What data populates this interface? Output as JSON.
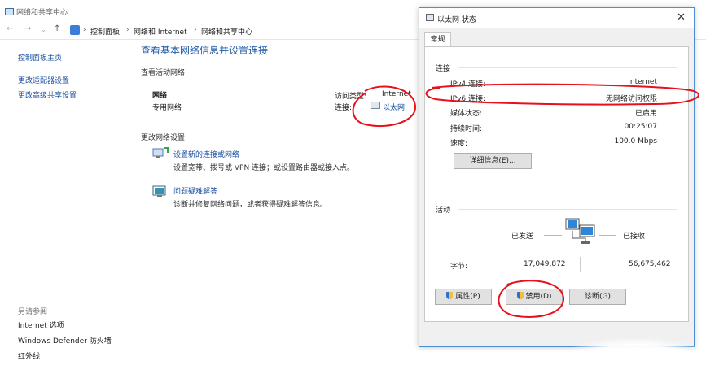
{
  "window": {
    "title": "网络和共享中心",
    "breadcrumb": [
      "控制面板",
      "网络和 Internet",
      "网络和共享中心"
    ]
  },
  "sidebar": {
    "home_link": "控制面板主页",
    "links": [
      "更改适配器设置",
      "更改高级共享设置"
    ],
    "see_also_label": "另请参阅",
    "see_also": [
      "Internet 选项",
      "Windows Defender 防火墙",
      "红外线"
    ]
  },
  "main": {
    "heading": "查看基本网络信息并设置连接",
    "active_networks_label": "查看活动网络",
    "network_name": "网络",
    "network_type": "专用网络",
    "access_type_label": "访问类型:",
    "access_type_value": "Internet",
    "connection_label": "连接:",
    "connection_value": "以太网",
    "change_settings_label": "更改网络设置",
    "items": [
      {
        "title": "设置新的连接或网络",
        "desc": "设置宽带、拨号或 VPN 连接；或设置路由器或接入点。"
      },
      {
        "title": "问题疑难解答",
        "desc": "诊断并修复网络问题，或者获得疑难解答信息。"
      }
    ]
  },
  "dialog": {
    "title": "以太网 状态",
    "tab": "常规",
    "connection_group": "连接",
    "fields": [
      {
        "key": "IPv4 连接:",
        "value": "Internet"
      },
      {
        "key": "IPv6 连接:",
        "value": "无网络访问权限"
      },
      {
        "key": "媒体状态:",
        "value": "已启用"
      },
      {
        "key": "持续时间:",
        "value": "00:25:07"
      },
      {
        "key": "速度:",
        "value": "100.0 Mbps"
      }
    ],
    "details_button": "详细信息(E)...",
    "activity_group": "活动",
    "sent_label": "已发送",
    "received_label": "已接收",
    "bytes_label": "字节:",
    "bytes_sent": "17,049,872",
    "bytes_received": "56,675,462",
    "buttons": {
      "properties": "属性(P)",
      "disable": "禁用(D)",
      "diagnose": "诊断(G)"
    }
  },
  "colors": {
    "link": "#1a4fa0",
    "heading": "#1e5aa8",
    "annotation": "#e8101a",
    "dialog_border": "#4a8fd6"
  }
}
